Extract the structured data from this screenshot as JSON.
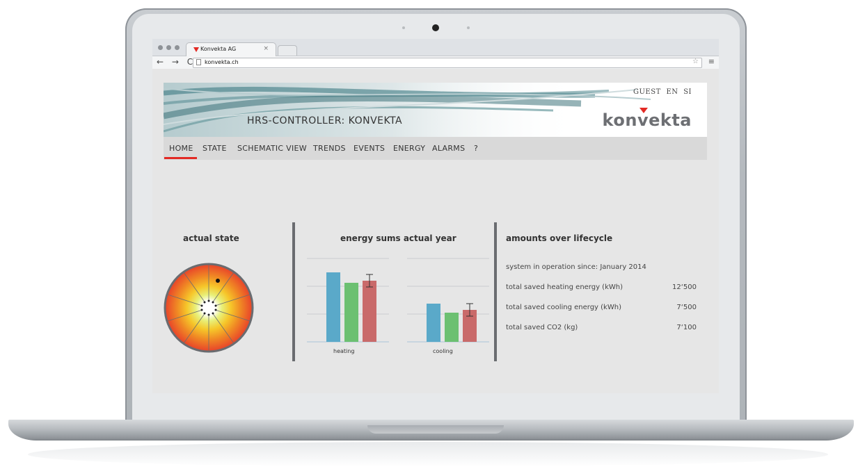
{
  "browser": {
    "tab_title": "Konvekta AG",
    "tab_close": "×",
    "nav_glyphs": "← → C",
    "url": "konvekta.ch",
    "star": "☆",
    "menu": "≡"
  },
  "header": {
    "title": "HRS-CONTROLLER: KONVEKTA",
    "user_links": [
      "GUEST",
      "EN",
      "SI"
    ],
    "brand_pre": "kon",
    "brand_v": "v",
    "brand_post": "ekta"
  },
  "nav": {
    "items": [
      "HOME",
      "STATE",
      "SCHEMATIC VIEW",
      "TRENDS",
      "EVENTS",
      "ENERGY",
      "ALARMS",
      "?"
    ],
    "active": "HOME"
  },
  "state_panel": {
    "title": "actual state"
  },
  "energy_panel": {
    "title": "energy sums actual year",
    "groups": [
      "heating",
      "cooling"
    ]
  },
  "lifecycle_panel": {
    "title": "amounts over lifecycle",
    "since": "system in operation since: January 2014",
    "rows": [
      {
        "label": "total saved heating energy (kWh)",
        "value": "12‘500"
      },
      {
        "label": "total saved cooling energy (kWh)",
        "value": "7‘500"
      },
      {
        "label": "total saved CO2 (kg)",
        "value": "7‘100"
      }
    ]
  },
  "chart_data": {
    "type": "bar",
    "categories": [
      "heating",
      "cooling"
    ],
    "series": [
      {
        "color": "#5aa9c9",
        "values": [
          100,
          55
        ]
      },
      {
        "color": "#6cc071",
        "values": [
          85,
          42
        ]
      },
      {
        "color": "#c96a6a",
        "values": [
          88,
          46
        ],
        "error": [
          9,
          9
        ]
      }
    ],
    "ylim": [
      0,
      120
    ],
    "grid": true
  },
  "colors": {
    "accent": "#e32a24",
    "divider": "#6a6c70"
  }
}
